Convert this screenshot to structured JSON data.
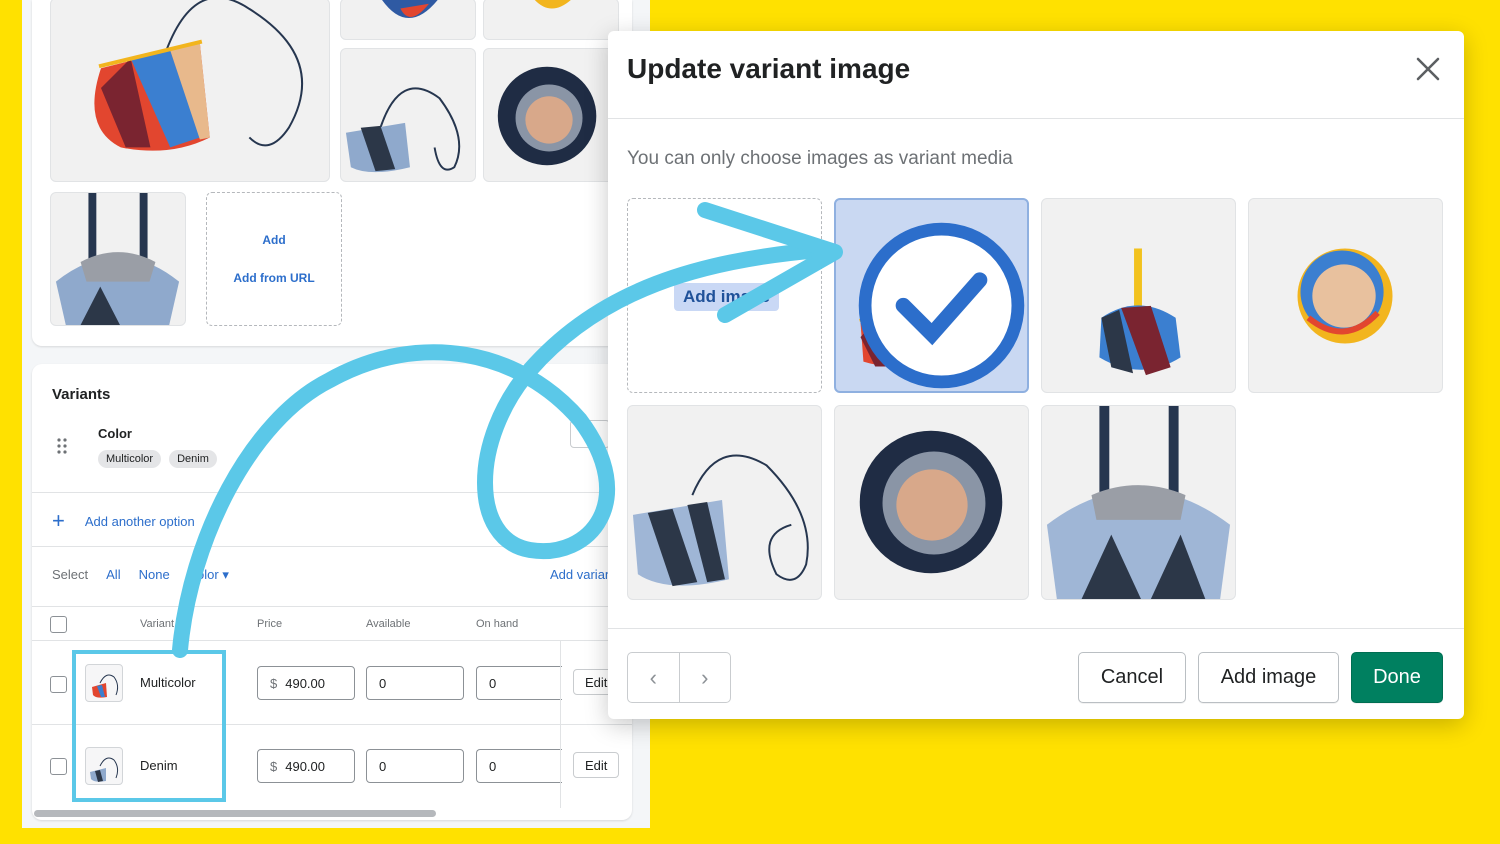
{
  "media": {
    "add_label": "Add",
    "add_url_label": "Add from URL"
  },
  "variants": {
    "title": "Variants",
    "option_name": "Color",
    "option_values": [
      "Multicolor",
      "Denim"
    ],
    "add_option": "Add another option",
    "select_label": "Select",
    "select_all": "All",
    "select_none": "None",
    "select_color": "Color",
    "add_variant": "Add variant",
    "columns": {
      "variant": "Variant",
      "price": "Price",
      "available": "Available",
      "on_hand": "On hand"
    },
    "rows": [
      {
        "label": "Multicolor",
        "currency": "$",
        "price": "490.00",
        "available": "0",
        "on_hand": "0",
        "edit": "Edit"
      },
      {
        "label": "Denim",
        "currency": "$",
        "price": "490.00",
        "available": "0",
        "on_hand": "0",
        "edit": "Edit"
      }
    ]
  },
  "modal": {
    "title": "Update variant image",
    "subtitle": "You can only choose images as variant media",
    "add_image_tile": "Add image",
    "cancel": "Cancel",
    "add_image": "Add image",
    "done": "Done",
    "prev_icon": "chevron-left-icon",
    "next_icon": "chevron-right-icon"
  },
  "colors": {
    "accent_primary": "#008060",
    "link": "#2c6ecb",
    "highlight": "#5bc8e8",
    "background": "#ffe100"
  }
}
